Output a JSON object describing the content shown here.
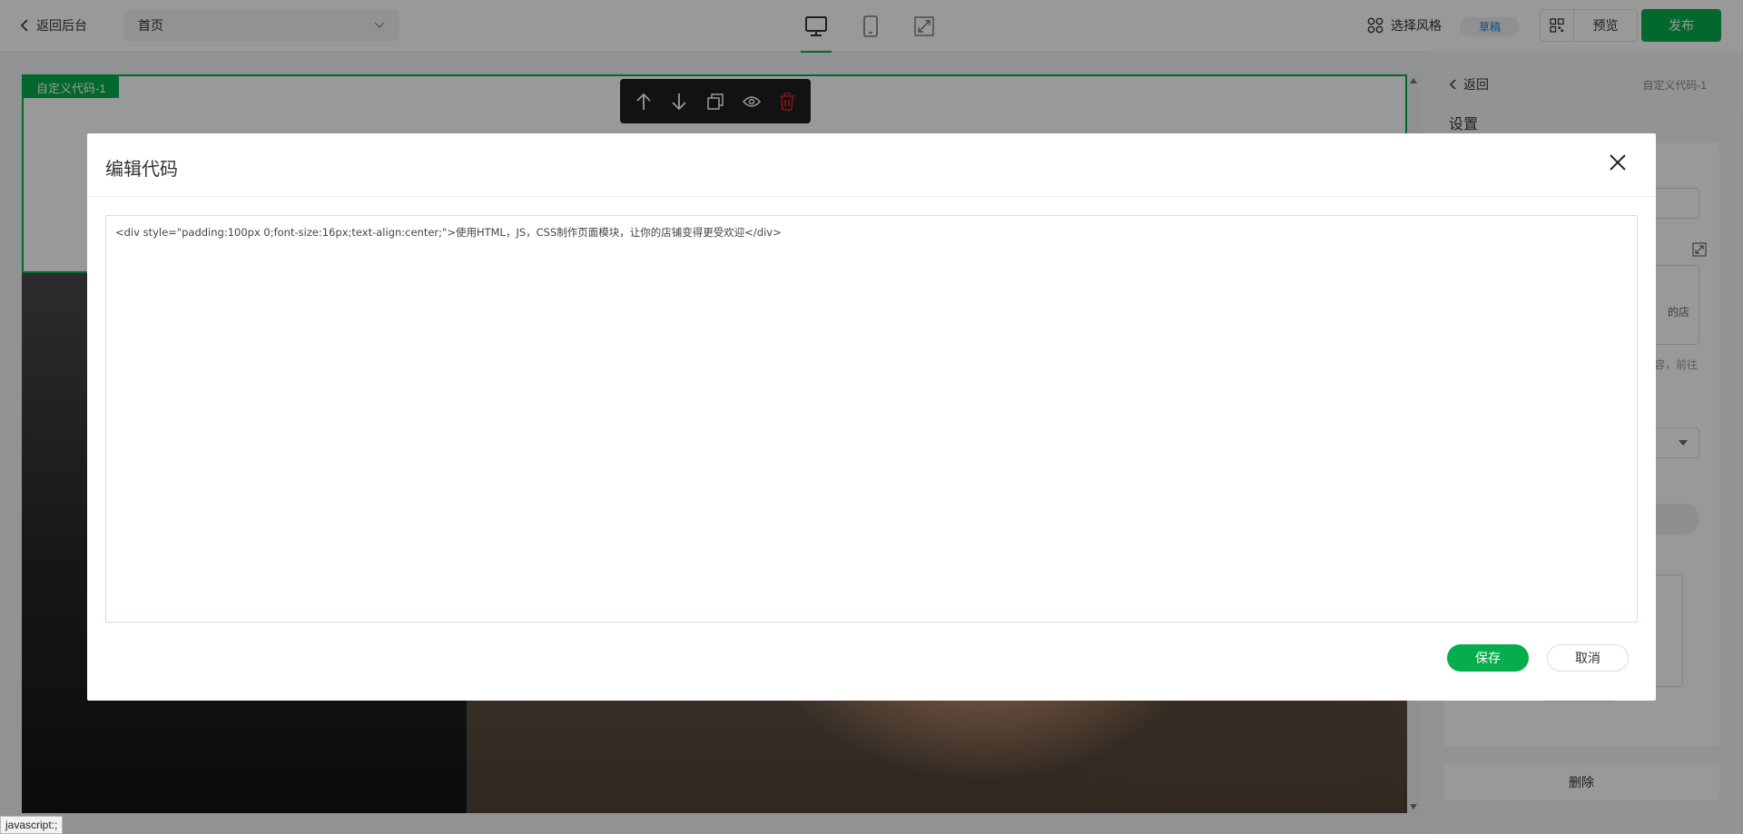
{
  "topbar": {
    "back_label": "返回后台",
    "page_select_value": "首页",
    "style_label": "选择风格",
    "draft_badge": "草稿",
    "preview_label": "预览",
    "publish_label": "发布",
    "accent_color": "#06ad4d"
  },
  "canvas": {
    "block_tag": "自定义代码-1"
  },
  "panel": {
    "back_label": "返回",
    "breadcrumb": "自定义代码-1",
    "settings_title": "设置",
    "code_preview_fragment": "的店",
    "hint_fragment": "容，前往",
    "delete_label": "删除"
  },
  "modal": {
    "title": "编辑代码",
    "code": "<div style=\"padding:100px 0;font-size:16px;text-align:center;\">使用HTML，JS，CSS制作页面模块，让你的店铺变得更受欢迎</div>",
    "save_label": "保存",
    "cancel_label": "取消"
  },
  "status_bar": {
    "link_tip": "javascript:;"
  }
}
